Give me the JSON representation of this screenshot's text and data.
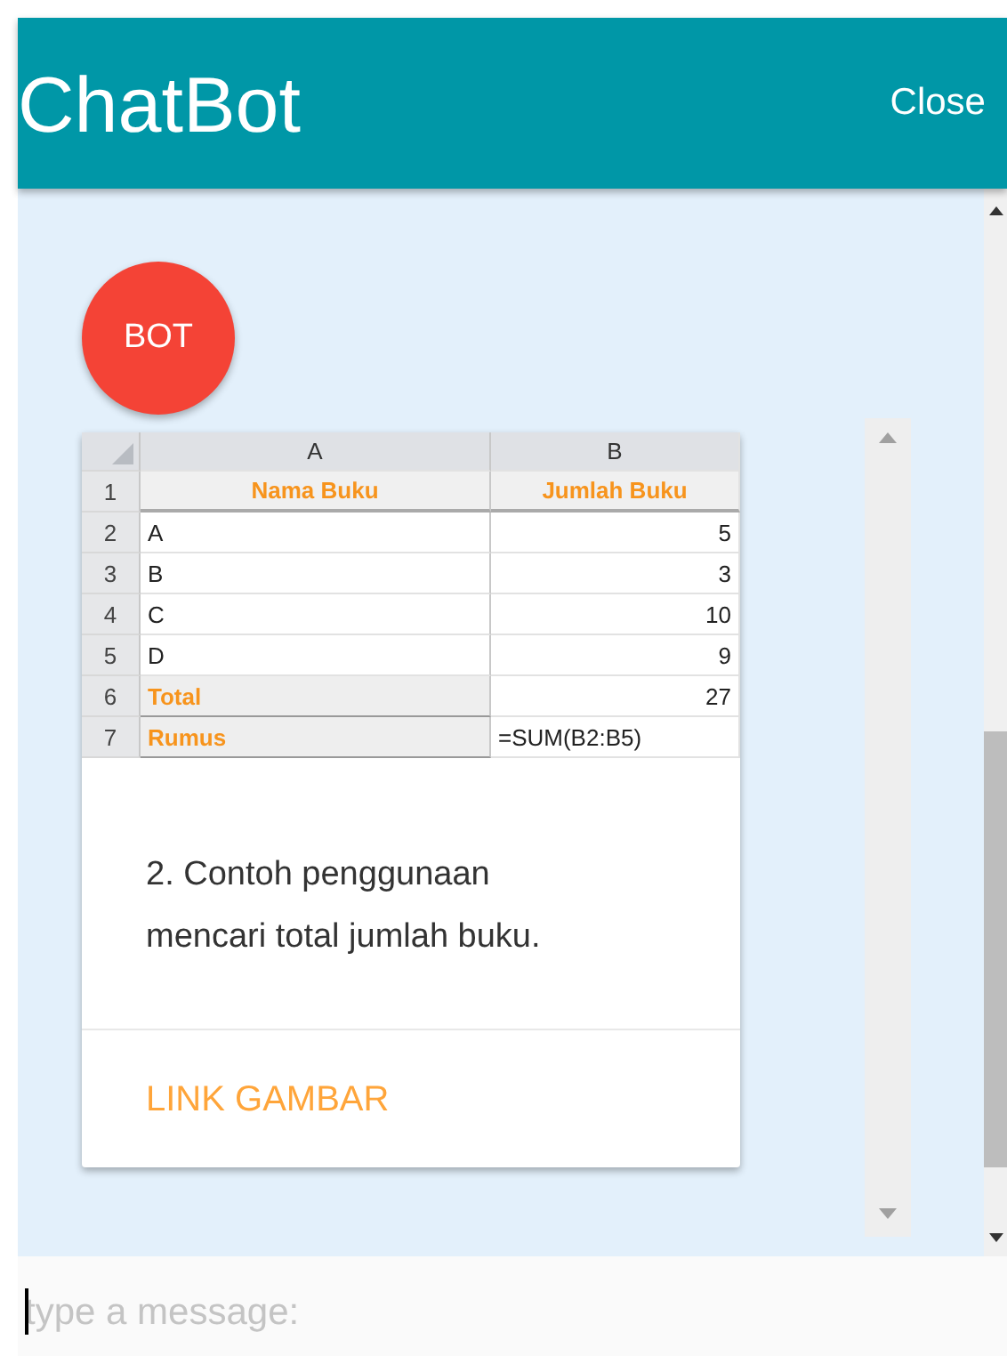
{
  "header": {
    "title": "ChatBot",
    "close": "Close"
  },
  "message": {
    "avatar": "BOT",
    "sheet": {
      "columns": [
        "A",
        "B"
      ],
      "rows": [
        {
          "num": "1",
          "kind": "header",
          "a": "Nama Buku",
          "b": "Jumlah Buku"
        },
        {
          "num": "2",
          "kind": "data",
          "a": "A",
          "b": "5"
        },
        {
          "num": "3",
          "kind": "data",
          "a": "B",
          "b": "3"
        },
        {
          "num": "4",
          "kind": "data",
          "a": "C",
          "b": "10"
        },
        {
          "num": "5",
          "kind": "data",
          "a": "D",
          "b": "9"
        },
        {
          "num": "6",
          "kind": "label",
          "a": "Total",
          "b": "27"
        },
        {
          "num": "7",
          "kind": "formula",
          "a": "Rumus",
          "b": "=SUM(B2:B5)"
        }
      ]
    },
    "text": "2. Contoh penggunaan mencari total jumlah buku.",
    "link": "LINK GAMBAR"
  },
  "input": {
    "placeholder": "type a message:"
  }
}
